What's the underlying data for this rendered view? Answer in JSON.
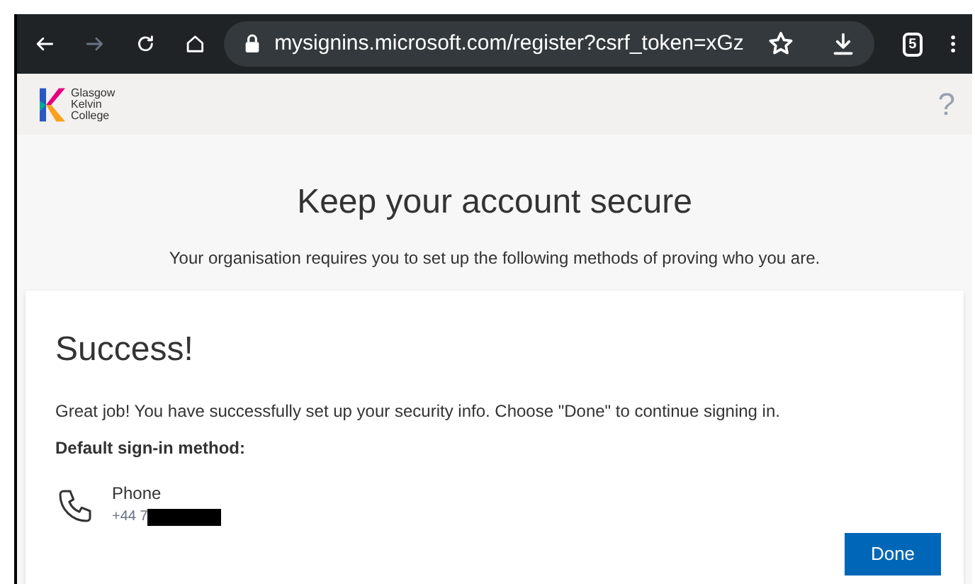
{
  "browser": {
    "url": "mysignins.microsoft.com/register?csrf_token=xGz",
    "tab_count": "5",
    "forward_disabled": true
  },
  "header": {
    "logo_lines": [
      "Glasgow",
      "Kelvin",
      "College"
    ],
    "help": "?"
  },
  "page": {
    "title": "Keep your account secure",
    "subtitle": "Your organisation requires you to set up the following methods of proving who you are."
  },
  "card": {
    "heading": "Success!",
    "message": "Great job! You have successfully set up your security info. Choose \"Done\" to continue signing in.",
    "default_label": "Default sign-in method:",
    "method": {
      "name": "Phone",
      "number": "+44 7",
      "redacted": true
    },
    "button": "Done"
  }
}
